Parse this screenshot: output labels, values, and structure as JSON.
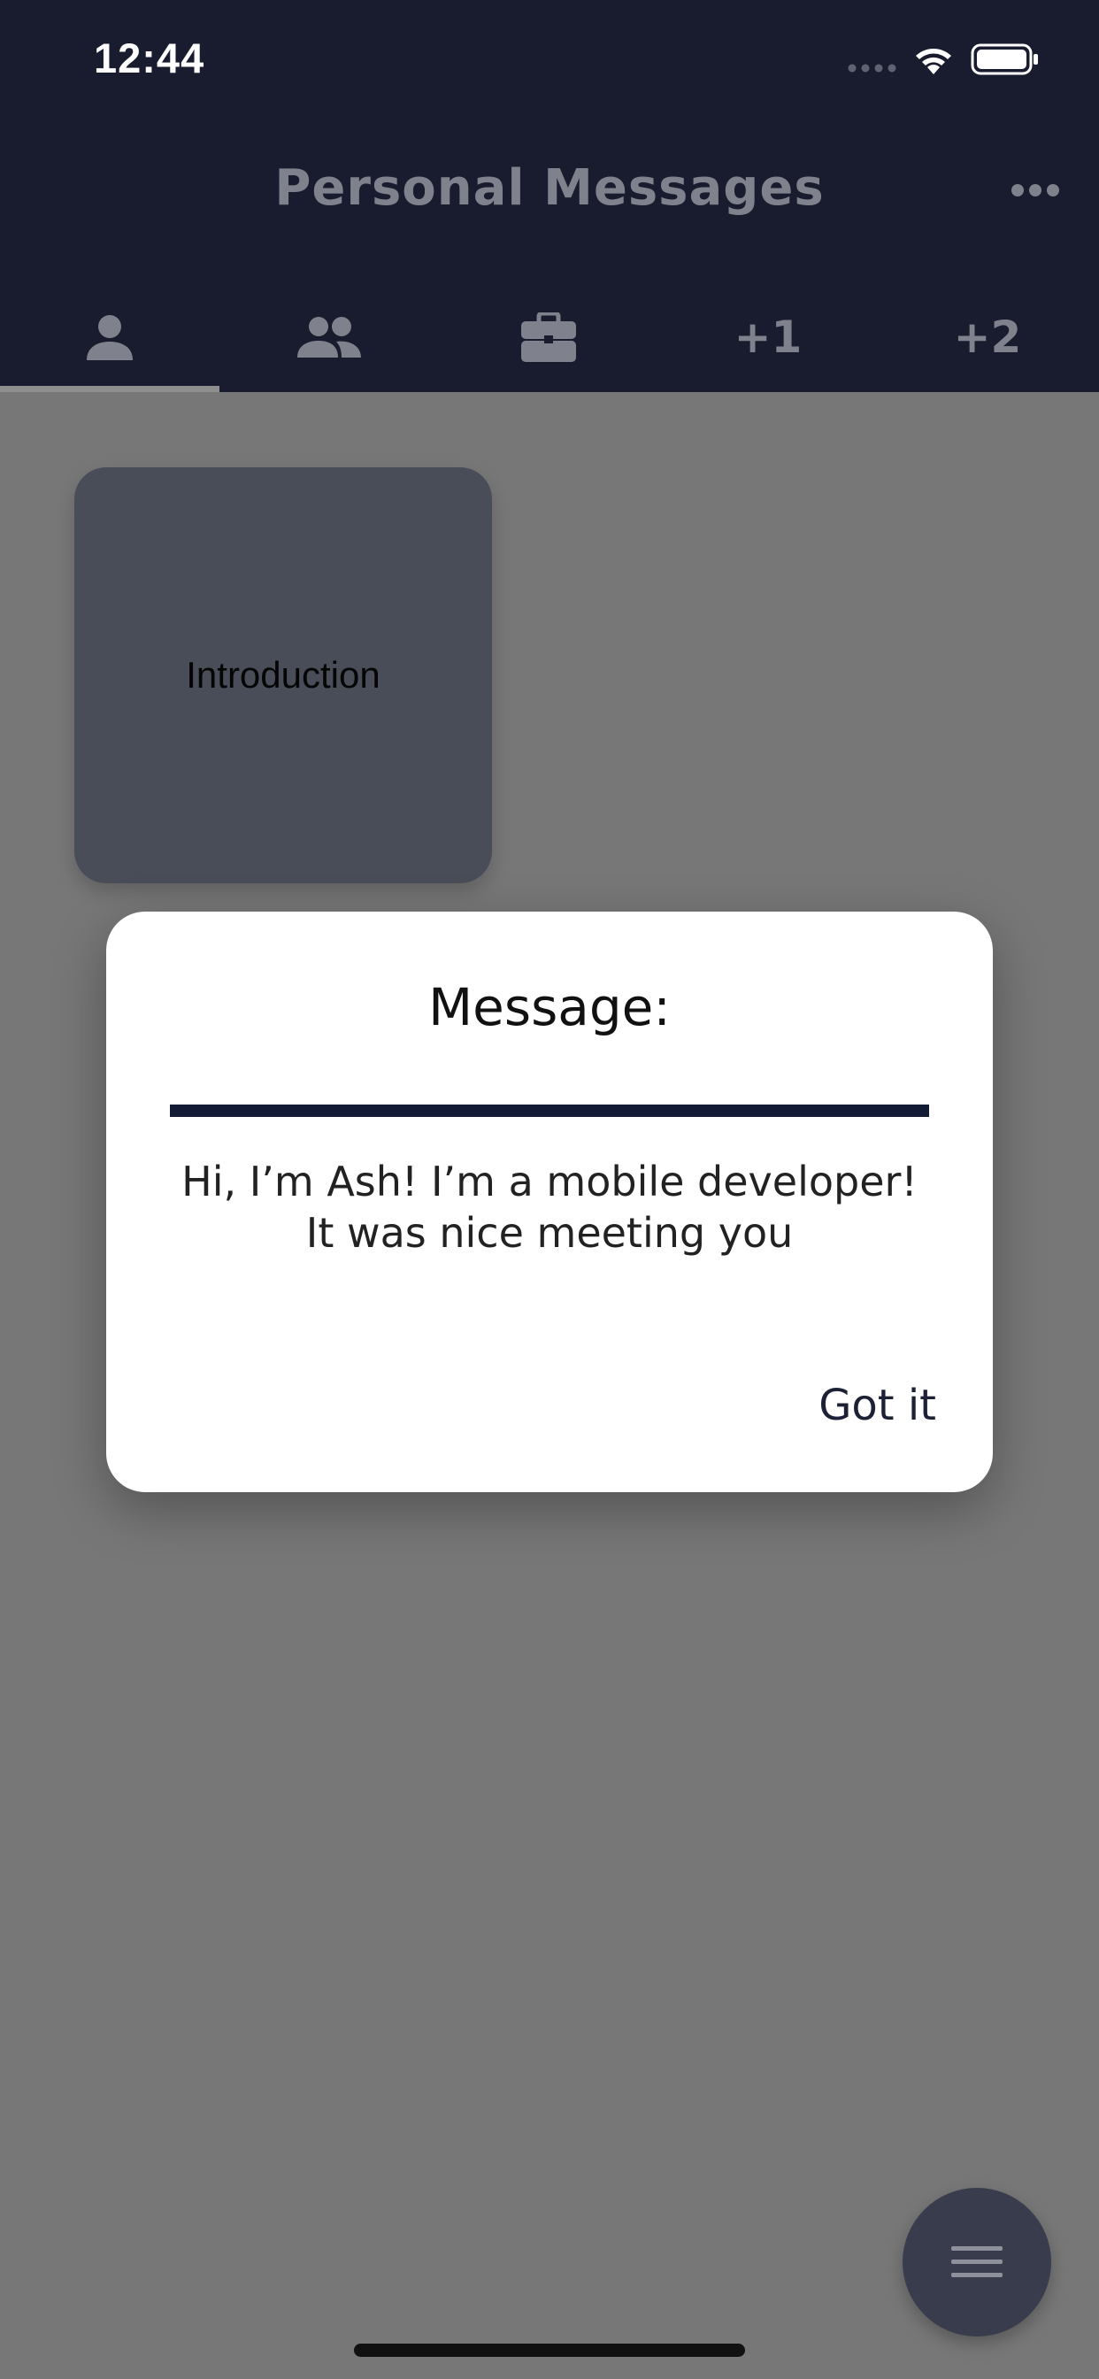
{
  "status_bar": {
    "time": "12:44"
  },
  "header": {
    "title": "Personal Messages",
    "more_icon": "more-horizontal-icon"
  },
  "tabs": [
    {
      "type": "icon",
      "icon": "person-icon",
      "selected": true
    },
    {
      "type": "icon",
      "icon": "people-icon",
      "selected": false
    },
    {
      "type": "icon",
      "icon": "briefcase-icon",
      "selected": false
    },
    {
      "type": "text",
      "label": "+1",
      "selected": false
    },
    {
      "type": "text",
      "label": "+2",
      "selected": false
    }
  ],
  "cards": [
    {
      "label": "Introduction"
    }
  ],
  "dialog": {
    "title": "Message:",
    "body": "Hi, I’m Ash! I’m a mobile developer! It was nice meeting you",
    "button_label": "Got it"
  },
  "fab": {
    "icon": "menu-icon"
  },
  "colors": {
    "header_bg": "#191c2e",
    "overlay_bg": "#777777",
    "card_bg": "#484d57",
    "divider": "#131a33",
    "fab_bg": "#393c4c"
  }
}
